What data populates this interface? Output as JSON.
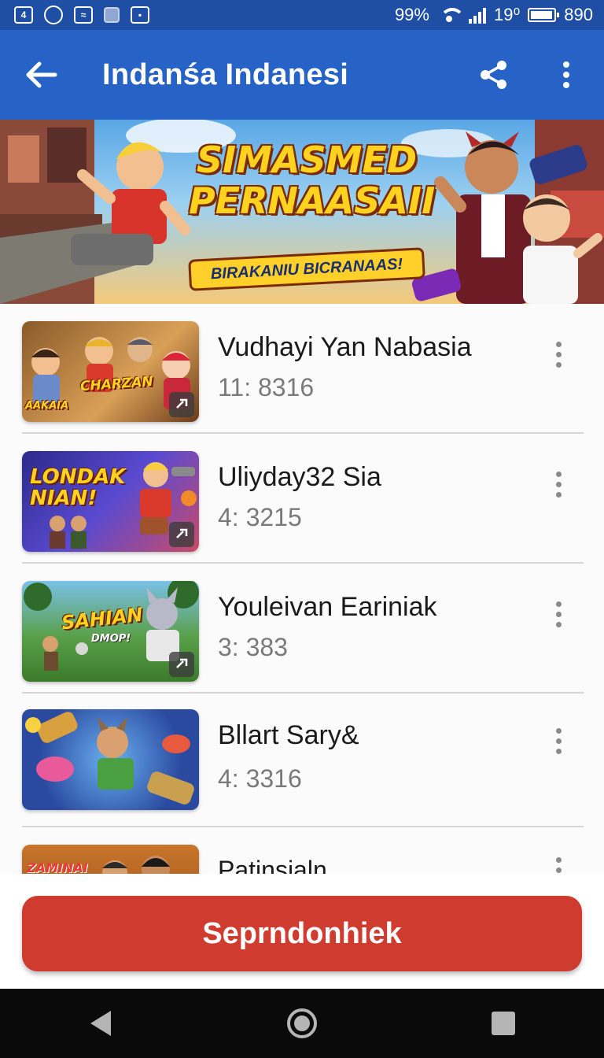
{
  "status_bar": {
    "battery_percent": "99%",
    "time_left": "19⁰",
    "time_right": "890",
    "battery_level": 0.95,
    "icons": [
      "notification-icon",
      "chrome-icon",
      "gallery-icon",
      "square-icon",
      "download-icon",
      "wifi-icon",
      "signal-icon",
      "battery-icon"
    ]
  },
  "app_bar": {
    "title": "Indanśa Indanesi",
    "back_icon": "arrow-left-icon",
    "share_icon": "share-icon",
    "more_icon": "more-vert-icon"
  },
  "banner": {
    "title_line1": "SIMASMED",
    "title_line2": "PERNAASAII",
    "subtitle": "BIRAKANIU BICRANAAS!"
  },
  "list": {
    "items": [
      {
        "title": "Vudhayi Yan Nabasia",
        "subtitle": "11: 8316",
        "thumb_text": "CHARZAN",
        "thumb_text2": "AAKAIA"
      },
      {
        "title": "Uliyday32 Sia",
        "subtitle": "4: 3215",
        "thumb_text": "LONDAK NIAN!",
        "thumb_text2": ""
      },
      {
        "title": "Youleivan Eariniak",
        "subtitle": "3: 383",
        "thumb_text": "SAHIAN",
        "thumb_text2": "DMOP!"
      },
      {
        "title": "Bllart Sary&",
        "subtitle": "4: 3316",
        "thumb_text": "",
        "thumb_text2": ""
      },
      {
        "title": "Patinsialn",
        "subtitle": "",
        "thumb_text": "ZAMINAI",
        "thumb_text2": ""
      }
    ]
  },
  "primary_button": {
    "label": "Seprndonhiek"
  },
  "nav_bar": {
    "icons": [
      "back-triangle-icon",
      "home-circle-icon",
      "recents-square-icon"
    ]
  },
  "colors": {
    "app_bar": "#2762c6",
    "status_bar": "#1f4fa5",
    "button": "#cf3b2f"
  }
}
